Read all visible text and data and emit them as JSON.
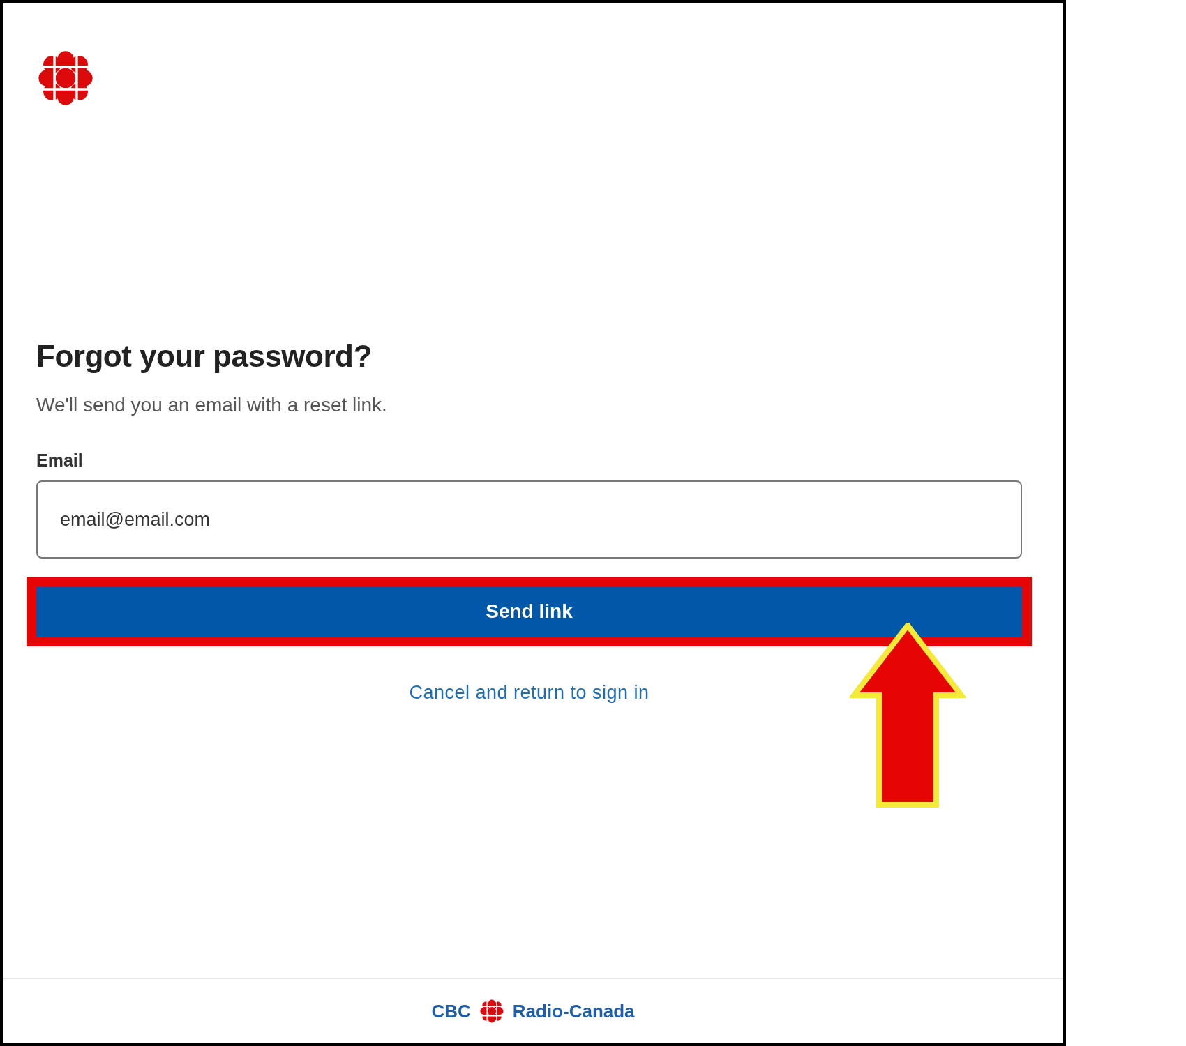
{
  "heading": "Forgot your password?",
  "subtitle": "We'll send you an email with a reset link.",
  "email_field": {
    "label": "Email",
    "value": "email@email.com"
  },
  "submit_button": "Send link",
  "cancel_link": "Cancel and return to sign in",
  "footer": {
    "brand_left": "CBC",
    "brand_right": "Radio-Canada"
  }
}
